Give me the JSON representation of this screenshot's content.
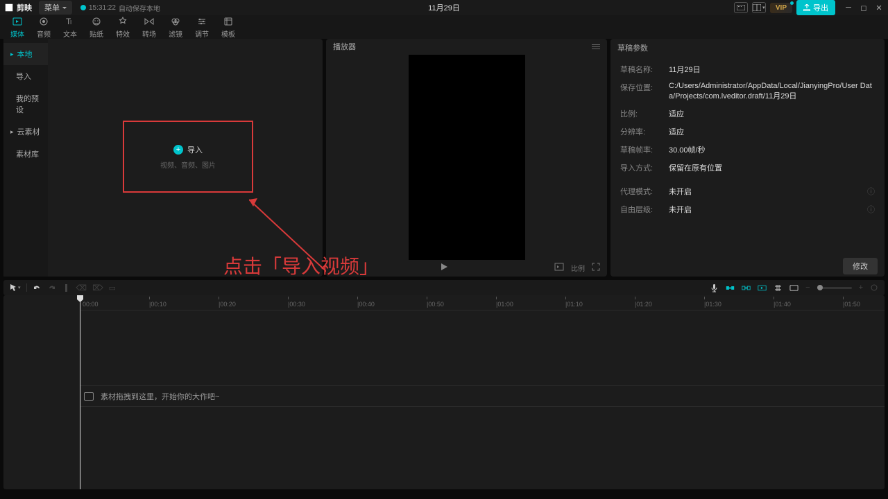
{
  "titlebar": {
    "app_name": "剪映",
    "menu_label": "菜单",
    "autosave_time": "15:31:22",
    "autosave_text": "自动保存本地",
    "project_title": "11月29日",
    "vip_label": "VIP",
    "export_label": "导出"
  },
  "toolbar": [
    {
      "label": "媒体",
      "icon": "media-icon",
      "active": true
    },
    {
      "label": "音频",
      "icon": "audio-icon"
    },
    {
      "label": "文本",
      "icon": "text-icon"
    },
    {
      "label": "贴纸",
      "icon": "sticker-icon"
    },
    {
      "label": "特效",
      "icon": "effect-icon"
    },
    {
      "label": "转场",
      "icon": "transition-icon"
    },
    {
      "label": "滤镜",
      "icon": "filter-icon"
    },
    {
      "label": "调节",
      "icon": "adjust-icon"
    },
    {
      "label": "模板",
      "icon": "template-icon"
    }
  ],
  "media_sidebar": {
    "items": [
      {
        "label": "本地",
        "active": true,
        "expandable": true
      },
      {
        "label": "导入"
      },
      {
        "label": "我的预设"
      },
      {
        "label": "云素材",
        "expandable": true
      },
      {
        "label": "素材库"
      }
    ]
  },
  "import_box": {
    "label": "导入",
    "sub": "视频、音频、图片"
  },
  "annotation_text": "点击「导入视频」",
  "player": {
    "header": "播放器",
    "ratio_label": "比例",
    "autofit_label": ""
  },
  "props": {
    "header": "草稿参数",
    "rows": [
      {
        "label": "草稿名称:",
        "value": "11月29日"
      },
      {
        "label": "保存位置:",
        "value": "C:/Users/Administrator/AppData/Local/JianyingPro/User Data/Projects/com.lveditor.draft/11月29日"
      },
      {
        "label": "比例:",
        "value": "适应"
      },
      {
        "label": "分辨率:",
        "value": "适应"
      },
      {
        "label": "草稿帧率:",
        "value": "30.00帧/秒"
      },
      {
        "label": "导入方式:",
        "value": "保留在原有位置"
      }
    ],
    "rows2": [
      {
        "label": "代理模式:",
        "value": "未开启"
      },
      {
        "label": "自由层级:",
        "value": "未开启"
      }
    ],
    "modify_btn": "修改"
  },
  "timeline": {
    "ticks": [
      "00:00",
      "|00:10",
      "|00:20",
      "|00:30",
      "|00:40",
      "|00:50",
      "|01:00",
      "|01:10",
      "|01:20",
      "|01:30",
      "|01:40",
      "|01:50"
    ],
    "placeholder": "素材拖拽到这里，开始你的大作吧~"
  }
}
